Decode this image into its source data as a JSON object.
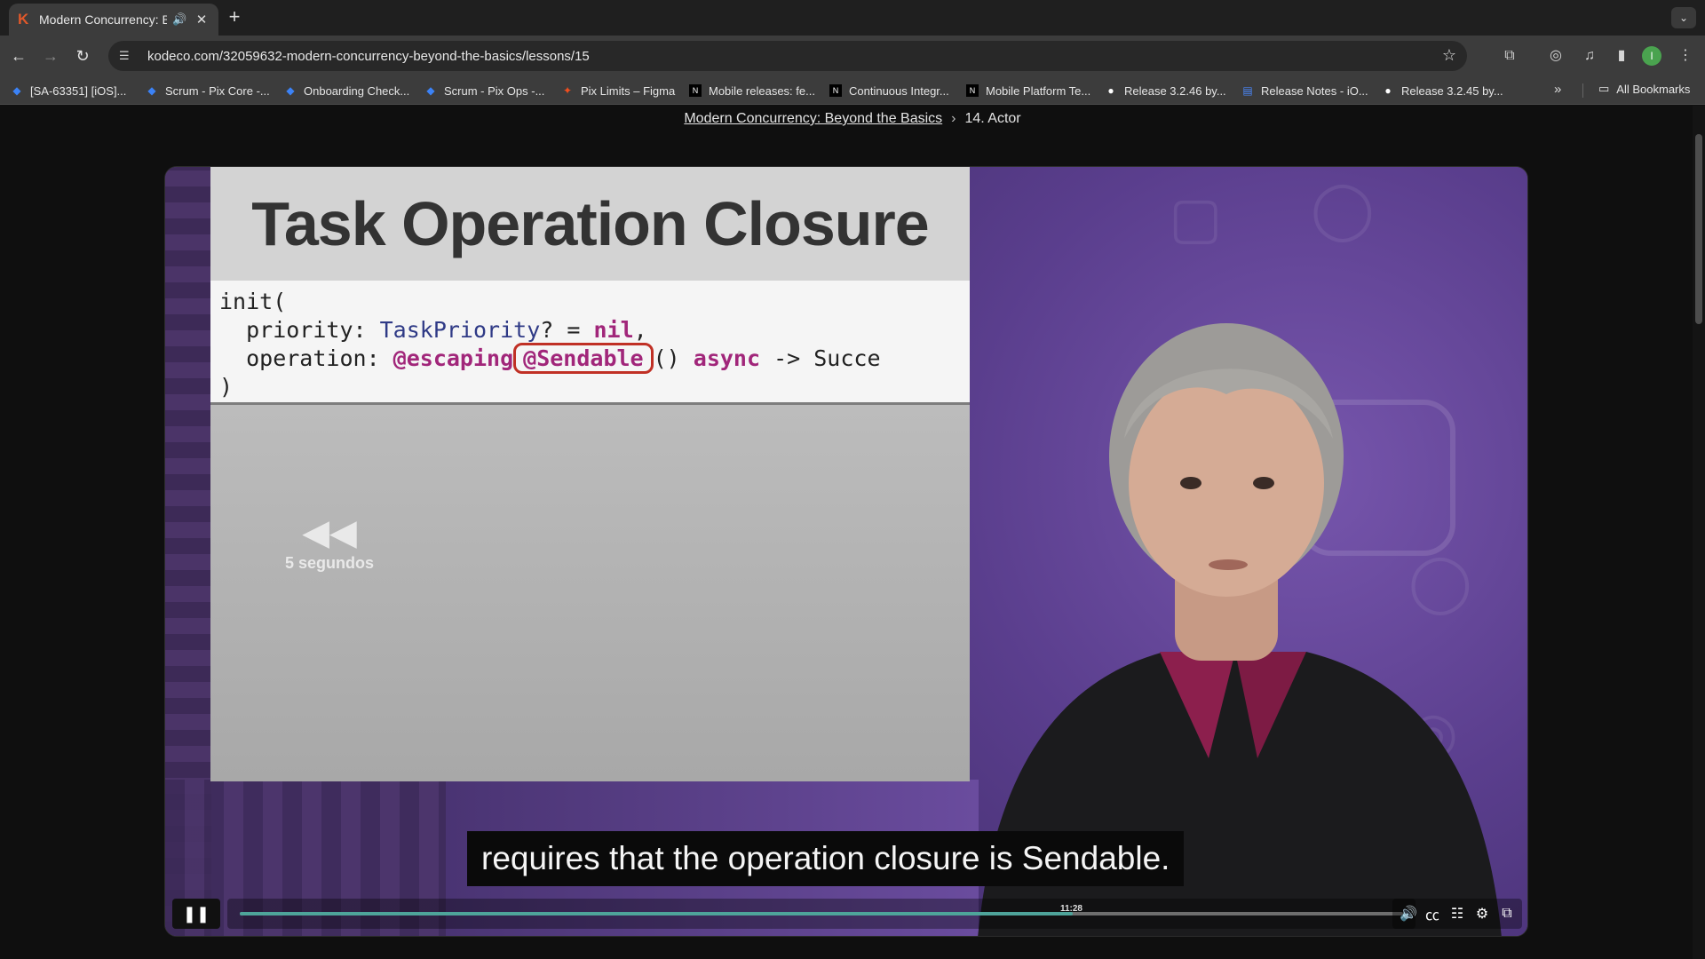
{
  "browser": {
    "tab": {
      "title": "Modern Concurrency: Bey",
      "favicon": "K"
    },
    "url": "kodeco.com/32059632-modern-concurrency-beyond-the-basics/lessons/15",
    "avatar_letter": "I",
    "bookmarks": [
      {
        "label": "[SA-63351] [iOS]...",
        "icon": "jira-icon"
      },
      {
        "label": "Scrum - Pix Core -...",
        "icon": "jira-icon"
      },
      {
        "label": "Onboarding Check...",
        "icon": "jira-icon"
      },
      {
        "label": "Scrum - Pix Ops -...",
        "icon": "jira-icon"
      },
      {
        "label": "Pix Limits – Figma",
        "icon": "figma-icon"
      },
      {
        "label": "Mobile releases: fe...",
        "icon": "notion-icon"
      },
      {
        "label": "Continuous Integr...",
        "icon": "notion-icon"
      },
      {
        "label": "Mobile Platform Te...",
        "icon": "notion-icon"
      },
      {
        "label": "Release 3.2.46 by...",
        "icon": "github-icon"
      },
      {
        "label": "Release Notes - iO...",
        "icon": "docs-icon"
      },
      {
        "label": "Release 3.2.45 by...",
        "icon": "github-icon"
      }
    ],
    "all_bookmarks": "All Bookmarks"
  },
  "breadcrumb": {
    "course": "Modern Concurrency: Beyond the Basics",
    "lesson": "14. Actor"
  },
  "video": {
    "slide_title": "Task Operation Closure",
    "code": {
      "l1": "init(",
      "l2_a": "  priority: ",
      "l2_type": "TaskPriority",
      "l2_b": "? = ",
      "l2_nil": "nil",
      "l2_c": ",",
      "l3_a": "  operation: ",
      "l3_escaping": "@escaping",
      "l3_sendable": "@Sendable",
      "l3_b": "() ",
      "l3_async": "async",
      "l3_c": " -> Succe",
      "l4": ")"
    },
    "rewind_label": "5 segundos",
    "caption": "requires that the operation closure is Sendable.",
    "time": "11:28",
    "progress_fraction": 0.716
  },
  "colors": {
    "accent_progress": "#4ea49a",
    "keyword": "#a1267a",
    "type": "#2f3a86",
    "highlight": "#c03025"
  }
}
